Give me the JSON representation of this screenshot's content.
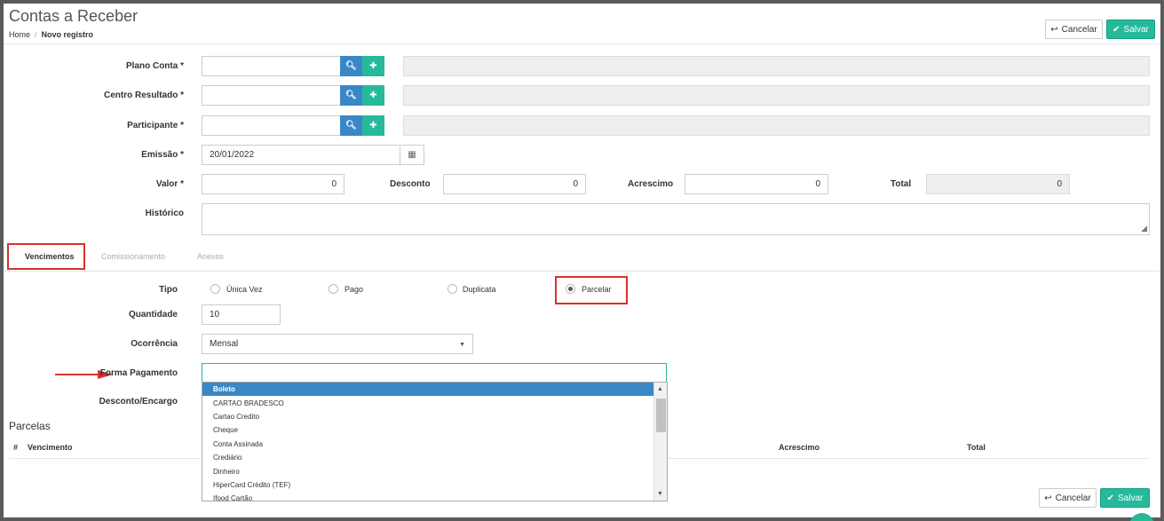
{
  "header": {
    "title": "Contas a Receber",
    "breadcrumb": {
      "home": "Home",
      "separator": "/",
      "current": "Novo registro"
    }
  },
  "actions": {
    "cancel": "Cancelar",
    "save": "Salvar"
  },
  "form": {
    "plano_conta": {
      "label": "Plano Conta",
      "required": "*",
      "value": ""
    },
    "centro_resultado": {
      "label": "Centro Resultado",
      "required": "*",
      "value": ""
    },
    "participante": {
      "label": "Participante",
      "required": "*",
      "value": ""
    },
    "emissao": {
      "label": "Emissão",
      "required": "*",
      "value": "20/01/2022"
    },
    "valor": {
      "label": "Valor",
      "required": "*",
      "value": "0"
    },
    "desconto": {
      "label": "Desconto",
      "value": "0"
    },
    "acrescimo": {
      "label": "Acrescimo",
      "value": "0"
    },
    "total": {
      "label": "Total",
      "value": "0"
    },
    "historico": {
      "label": "Histórico",
      "value": ""
    }
  },
  "tabs": [
    {
      "label": "Vencimentos",
      "active": true
    },
    {
      "label": "Comissionamento",
      "active": false
    },
    {
      "label": "Anexos",
      "active": false
    }
  ],
  "vencimentos": {
    "tipo": {
      "label": "Tipo",
      "options": [
        "Única Vez",
        "Pago",
        "Duplicata",
        "Parcelar"
      ],
      "selected": "Parcelar"
    },
    "quantidade": {
      "label": "Quantidade",
      "value": "10"
    },
    "ocorrencia": {
      "label": "Ocorrência",
      "value": "Mensal"
    },
    "forma_pagamento": {
      "label": "Forma Pagamento",
      "value": "",
      "options": [
        "Boleto",
        "CARTAO BRADESCO",
        "Cartao Credito",
        "Cheque",
        "Conta Assinada",
        "Crediário",
        "Dinheiro",
        "HiperCard Crédito (TEF)",
        "Ifood Cartão"
      ],
      "highlighted": "Boleto"
    },
    "desconto_encargo": {
      "label": "Desconto/Encargo"
    }
  },
  "parcelas": {
    "title": "Parcelas",
    "columns": [
      "#",
      "Vencimento",
      "Acrescimo",
      "Total"
    ]
  },
  "colors": {
    "primary": "#3a87c8",
    "success": "#26b99a",
    "highlight": "#d9302c"
  }
}
